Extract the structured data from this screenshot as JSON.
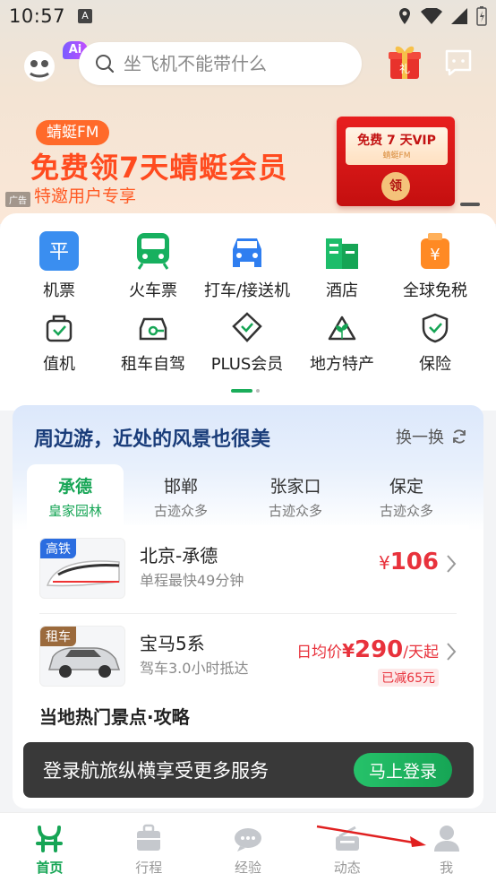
{
  "status_bar": {
    "time": "10:57"
  },
  "search": {
    "placeholder": "坐飞机不能带什么"
  },
  "ai_badge": "Ai",
  "banner": {
    "tag": "蜻蜓FM",
    "title": "免费领7天蜻蜓会员",
    "subtitle": "特邀用户专享",
    "ad_label": "广告",
    "envelope_text": "免费 7 天VIP",
    "envelope_brand": "蜻蜓FM",
    "envelope_seal": "领",
    "gift_text": "礼"
  },
  "services": {
    "row1": [
      {
        "label": "机票",
        "icon": "flight-icon"
      },
      {
        "label": "火车票",
        "icon": "train-icon"
      },
      {
        "label": "打车/接送机",
        "icon": "taxi-icon"
      },
      {
        "label": "酒店",
        "icon": "hotel-icon"
      },
      {
        "label": "全球免税",
        "icon": "dutyfree-icon"
      }
    ],
    "row2": [
      {
        "label": "值机",
        "icon": "checkin-icon"
      },
      {
        "label": "租车自驾",
        "icon": "car-rental-icon"
      },
      {
        "label": "PLUS会员",
        "icon": "plus-member-icon"
      },
      {
        "label": "地方特产",
        "icon": "local-specialty-icon"
      },
      {
        "label": "保险",
        "icon": "insurance-icon"
      }
    ],
    "icon_glyphs": {
      "flight": "平",
      "dutyfree": "¥"
    }
  },
  "travel": {
    "title": "周边游，近处的风景也很美",
    "refresh_label": "换一换",
    "tabs": [
      {
        "name": "承德",
        "sub": "皇家园林"
      },
      {
        "name": "邯郸",
        "sub": "古迹众多"
      },
      {
        "name": "张家口",
        "sub": "古迹众多"
      },
      {
        "name": "保定",
        "sub": "古迹众多"
      }
    ],
    "trips": [
      {
        "badge": "高铁",
        "name": "北京-承德",
        "desc": "单程最快49分钟",
        "price_symbol": "¥",
        "price": "106"
      },
      {
        "badge": "租车",
        "name": "宝马5系",
        "desc": "驾车3.0小时抵达",
        "price_prefix": "日均价",
        "price_symbol": "¥",
        "price": "290",
        "price_suffix": "/天起",
        "discount": "已减65元"
      }
    ],
    "hot_title": "当地热门景点·攻略"
  },
  "login_toast": {
    "text": "登录航旅纵横享受更多服务",
    "button": "马上登录"
  },
  "bottom_nav": [
    {
      "label": "首页",
      "icon": "home-icon",
      "active": true
    },
    {
      "label": "行程",
      "icon": "trip-icon",
      "active": false
    },
    {
      "label": "经验",
      "icon": "experience-icon",
      "active": false
    },
    {
      "label": "动态",
      "icon": "dynamic-icon",
      "active": false
    },
    {
      "label": "我",
      "icon": "profile-icon",
      "active": false
    }
  ],
  "colors": {
    "brand_green": "#16a555",
    "price_red": "#e8323c",
    "banner_orange": "#ff4b1f"
  }
}
